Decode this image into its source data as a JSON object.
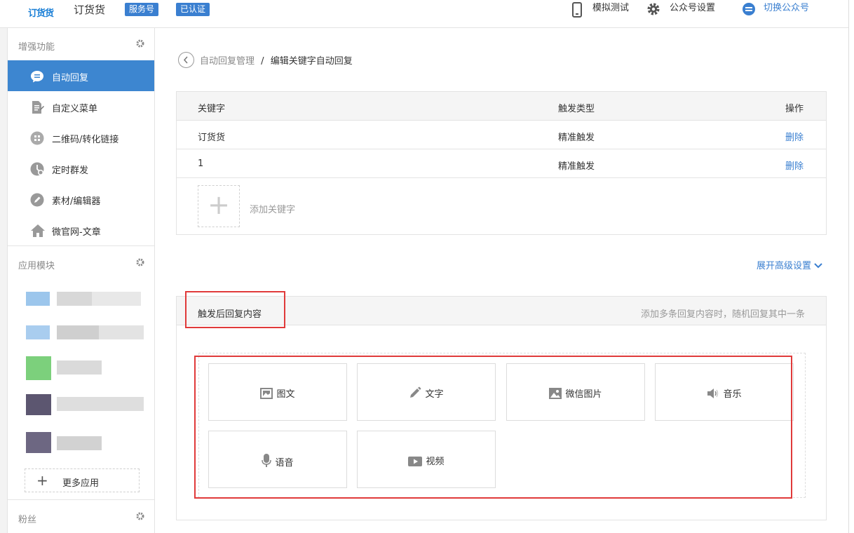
{
  "header": {
    "logo_text": "订货货",
    "app_name": "订货货",
    "badges": [
      "服务号",
      "已认证"
    ],
    "links": {
      "simulate": "模拟测试",
      "settings": "公众号设置",
      "switch": "切换公众号"
    }
  },
  "sidebar": {
    "section_enhance": "增强功能",
    "items": [
      {
        "label": "自动回复",
        "icon": "chat-bubble-icon",
        "active": true
      },
      {
        "label": "自定义菜单",
        "icon": "document-edit-icon"
      },
      {
        "label": "二维码/转化链接",
        "icon": "qrcode-icon"
      },
      {
        "label": "定时群发",
        "icon": "clock-icon"
      },
      {
        "label": "素材/编辑器",
        "icon": "pencil-icon"
      },
      {
        "label": "微官网-文章",
        "icon": "home-icon"
      }
    ],
    "section_apps": "应用模块",
    "more_apps": "更多应用",
    "section_fans": "粉丝"
  },
  "breadcrumb": {
    "parent": "自动回复管理",
    "separator": "/",
    "current": "编辑关键字自动回复"
  },
  "keyword_table": {
    "headers": [
      "关键字",
      "触发类型",
      "操作"
    ],
    "rows": [
      {
        "keyword": "订货货",
        "type": "精准触发",
        "action": "删除"
      },
      {
        "keyword": "1",
        "type": "精准触发",
        "action": "删除"
      }
    ],
    "add_label": "添加关键字",
    "add_symbol": "+"
  },
  "advanced_toggle": "展开高级设置",
  "reply_section": {
    "title": "触发后回复内容",
    "hint": "添加多条回复内容时，随机回复其中一条",
    "types": [
      {
        "label": "图文",
        "icon": "image-text-icon"
      },
      {
        "label": "文字",
        "icon": "pencil-icon"
      },
      {
        "label": "微信图片",
        "icon": "picture-icon"
      },
      {
        "label": "音乐",
        "icon": "speaker-icon"
      },
      {
        "label": "语音",
        "icon": "microphone-icon"
      },
      {
        "label": "视频",
        "icon": "video-icon"
      }
    ]
  },
  "colors": {
    "accent": "#3a7fd0",
    "active_bg": "#3d86d0",
    "highlight": "#e03a3a"
  }
}
